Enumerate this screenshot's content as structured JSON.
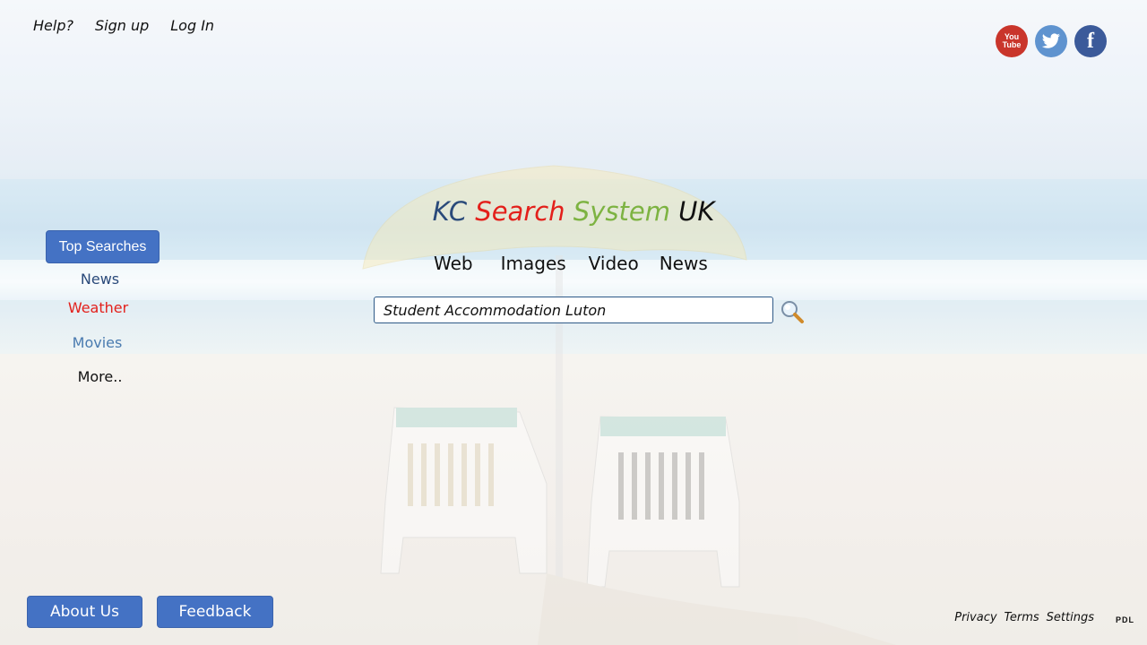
{
  "top_nav": {
    "help": "Help?",
    "signup": "Sign up",
    "login": "Log In"
  },
  "social": {
    "youtube_top": "You",
    "youtube_bottom": "Tube",
    "facebook": "f"
  },
  "logo": {
    "part1": "KC",
    "part2": "Search",
    "part3": "System",
    "part4": "UK"
  },
  "tabs": [
    "Web",
    "Images",
    "Video",
    "News"
  ],
  "search": {
    "value": "Student Accommodation Luton"
  },
  "sidebar": {
    "top_searches": "Top Searches",
    "items": [
      "News",
      "Weather",
      "Movies",
      "More.."
    ]
  },
  "buttons": {
    "about": "About Us",
    "feedback": "Feedback"
  },
  "footer": {
    "privacy": "Privacy",
    "terms": "Terms",
    "settings": "Settings",
    "corner": "PDL"
  },
  "colors": {
    "button": "#4472c4",
    "logo_kc": "#2a4a7a",
    "logo_search": "#e3201b",
    "logo_system": "#7db342",
    "logo_uk": "#111111",
    "sidebar_news": "#2a4a7a",
    "sidebar_weather": "#e3201b",
    "sidebar_movies": "#4a7bb0",
    "sidebar_more": "#111111"
  }
}
